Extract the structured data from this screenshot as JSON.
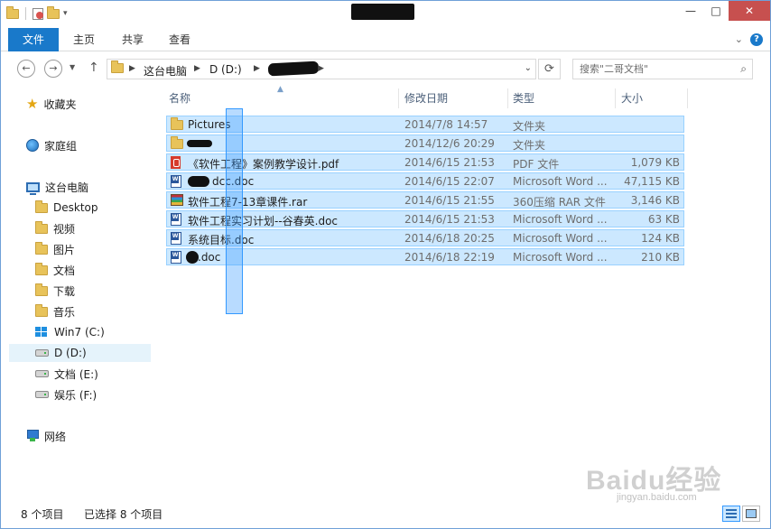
{
  "ribbon": {
    "tabs": [
      "文件",
      "主页",
      "共享",
      "查看"
    ]
  },
  "address": {
    "crumbs": [
      "这台电脑",
      "D (D:)"
    ]
  },
  "search": {
    "placeholder": "搜索\"二哥文档\""
  },
  "nav_pane": {
    "favorites": "收藏夹",
    "homegroup": "家庭组",
    "this_pc": "这台电脑",
    "pc_items": [
      "Desktop",
      "视频",
      "图片",
      "文档",
      "下载",
      "音乐",
      "Win7 (C:)",
      "D (D:)",
      "文档 (E:)",
      "娱乐 (F:)"
    ],
    "network": "网络"
  },
  "columns": {
    "name": "名称",
    "modified": "修改日期",
    "type": "类型",
    "size": "大小"
  },
  "files": [
    {
      "name": "Pictures",
      "modified": "2014/7/8 14:57",
      "type": "文件夹",
      "size": "",
      "icon": "folder-icon"
    },
    {
      "name": "",
      "modified": "2014/12/6 20:29",
      "type": "文件夹",
      "size": "",
      "icon": "folder-icon"
    },
    {
      "name": "《软件工程》案例教学设计.pdf",
      "modified": "2014/6/15 21:53",
      "type": "PDF 文件",
      "size": "1,079 KB",
      "icon": "pdf-icon"
    },
    {
      "name": "dcc.doc",
      "modified": "2014/6/15 22:07",
      "type": "Microsoft Word ...",
      "size": "47,115 KB",
      "icon": "word-doc-icon"
    },
    {
      "name": "软件工程7-13章课件.rar",
      "modified": "2014/6/15 21:55",
      "type": "360压缩 RAR 文件",
      "size": "3,146 KB",
      "icon": "rar-archive-icon"
    },
    {
      "name": "软件工程实习计划--谷春英.doc",
      "modified": "2014/6/15 21:53",
      "type": "Microsoft Word ...",
      "size": "63 KB",
      "icon": "word-doc-icon"
    },
    {
      "name": "系统目标.doc",
      "modified": "2014/6/18 20:25",
      "type": "Microsoft Word ...",
      "size": "124 KB",
      "icon": "word-doc-icon"
    },
    {
      "name": ".doc",
      "modified": "2014/6/18 22:19",
      "type": "Microsoft Word ...",
      "size": "210 KB",
      "icon": "word-doc-icon"
    }
  ],
  "status": {
    "count": "8 个项目",
    "selected": "已选择 8 个项目"
  },
  "watermark": {
    "brand": "Baidu经验",
    "url": "jingyan.baidu.com"
  },
  "colors": {
    "accent": "#1979ca",
    "selection": "#cce8ff",
    "selection_border": "#99d1ff",
    "close": "#c7504f"
  }
}
